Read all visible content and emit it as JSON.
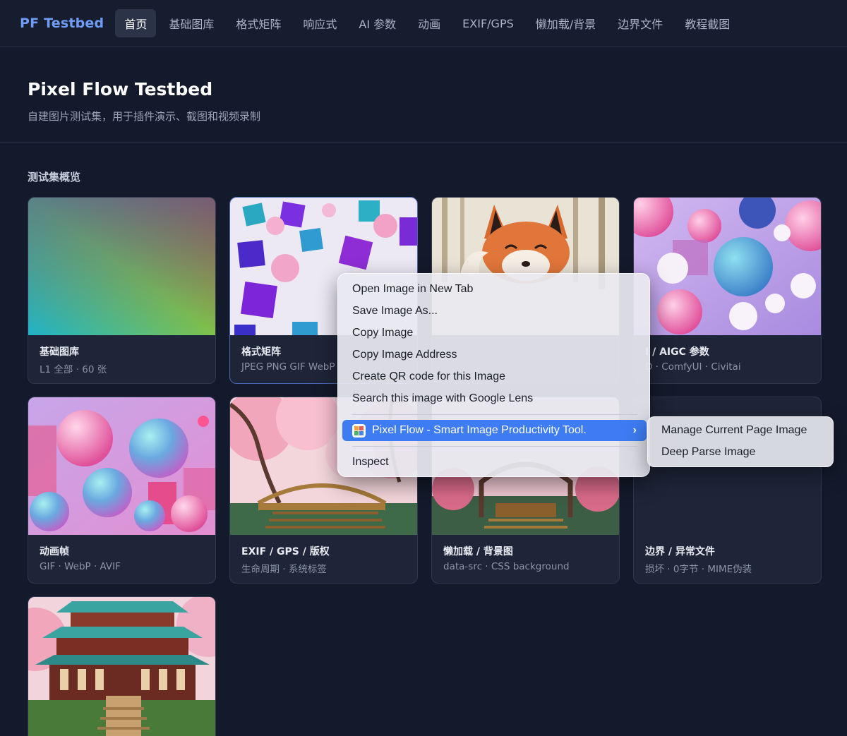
{
  "nav": {
    "brand": "PF Testbed",
    "items": [
      {
        "label": "首页",
        "active": true
      },
      {
        "label": "基础图库"
      },
      {
        "label": "格式矩阵"
      },
      {
        "label": "响应式"
      },
      {
        "label": "AI 参数"
      },
      {
        "label": "动画"
      },
      {
        "label": "EXIF/GPS"
      },
      {
        "label": "懒加载/背景"
      },
      {
        "label": "边界文件"
      },
      {
        "label": "教程截图"
      }
    ]
  },
  "header": {
    "title": "Pixel Flow Testbed",
    "subtitle": "自建图片测试集，用于插件演示、截图和视频录制"
  },
  "section": {
    "title": "测试集概览"
  },
  "cards": [
    {
      "title": "基础图库",
      "subtitle": "L1 全部 · 60 张",
      "image": "gradient"
    },
    {
      "title": "格式矩阵",
      "subtitle": "JPEG PNG GIF WebP",
      "image": "cubes"
    },
    {
      "title": "",
      "subtitle": "",
      "image": "fox"
    },
    {
      "title": "I / AIGC 参数",
      "subtitle": "D · ComfyUI · Civitai",
      "image": "spheres-pink"
    },
    {
      "title": "动画帧",
      "subtitle": "GIF · WebP · AVIF",
      "image": "spheres-3d"
    },
    {
      "title": "EXIF / GPS / 版权",
      "subtitle": "生命周期 · 系统标签",
      "image": "sakura-bridge"
    },
    {
      "title": "懒加载 / 背景图",
      "subtitle": "data-src · CSS background",
      "image": "garden-gate"
    },
    {
      "title": "边界 / 异常文件",
      "subtitle": "损坏 · 0字节 · MIME伪装",
      "image": "empty"
    },
    {
      "title": "",
      "subtitle": "",
      "image": "temple"
    }
  ],
  "context_menu": {
    "items": [
      "Open Image in New Tab",
      "Save Image As...",
      "Copy Image",
      "Copy Image Address",
      "Create QR code for this Image",
      "Search this image with Google Lens"
    ],
    "extension_item": "Pixel Flow - Smart Image Productivity Tool.",
    "inspect": "Inspect",
    "submenu": [
      "Manage Current Page Image",
      "Deep Parse Image"
    ]
  },
  "colors": {
    "accent": "#3d7cf2",
    "brand": "#6f9cf5",
    "background": "#131a2b"
  }
}
